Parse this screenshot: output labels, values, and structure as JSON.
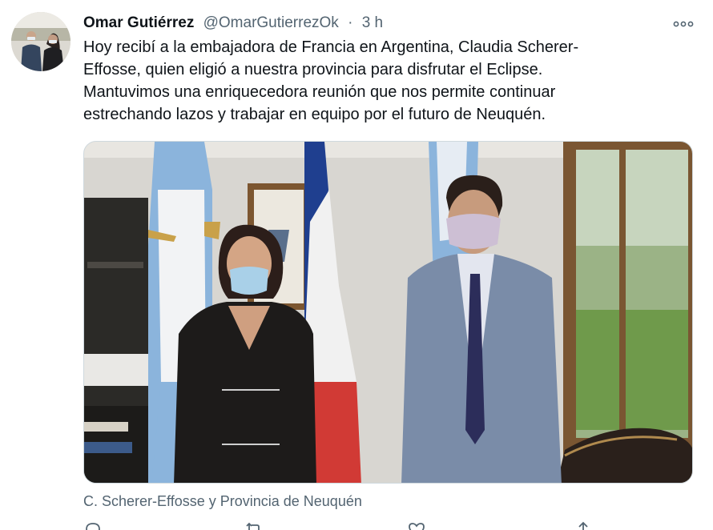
{
  "tweet": {
    "author_name": "Omar Gutiérrez",
    "handle": "@OmarGutierrezOk",
    "separator": "·",
    "time": "3 h",
    "more_icon": "more-horizontal-icon",
    "lines": [
      "Hoy recibí a la embajadora de Francia en Argentina, Claudia Scherer-",
      "Effosse, quien eligió a nuestra provincia para disfrutar el Eclipse.",
      "Mantuvimos una enriquecedora reunión que nos permite continuar",
      "estrechando lazos y trabajar en equipo por el futuro de Neuquén."
    ],
    "media_caption": "C. Scherer-Effosse y Provincia de Neuquén"
  },
  "actions": [
    {
      "name": "reply",
      "icon": "reply-icon"
    },
    {
      "name": "retweet",
      "icon": "retweet-icon"
    },
    {
      "name": "like",
      "icon": "heart-icon"
    },
    {
      "name": "share",
      "icon": "share-icon"
    }
  ],
  "colors": {
    "text_primary": "#0f1419",
    "text_secondary": "#536471",
    "border": "#cfd9de"
  }
}
